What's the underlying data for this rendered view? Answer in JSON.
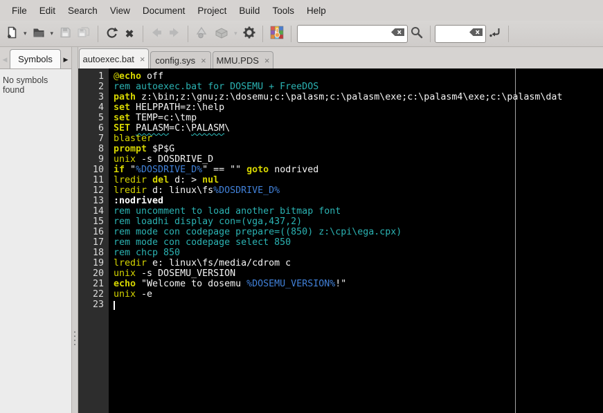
{
  "chrome_colors": {
    "window_bg": "#d6d3d1",
    "toolbar_border": "#b4b1ae",
    "active_tab_bg": "#f2f1f0",
    "inactive_tab_bg": "#d0cdcb",
    "sidebar_bg": "#ececec",
    "entry_bg": "#ffffff"
  },
  "menubar": {
    "items": [
      "File",
      "Edit",
      "Search",
      "View",
      "Document",
      "Project",
      "Build",
      "Tools",
      "Help"
    ]
  },
  "ui": {
    "close_glyph": "×",
    "close_button_glyph": "✖",
    "caret_glyph": "▾",
    "left_arrow_glyph": "◀",
    "right_arrow_glyph": "▶"
  },
  "toolbar": {
    "search_value": "",
    "goto_value": "",
    "icons": [
      "new-document",
      "open-document",
      "save",
      "save-all",
      "revert",
      "close-document",
      "navigate-back",
      "navigate-forward",
      "compile",
      "build",
      "execute-gear",
      "color-chooser",
      "search-magnifier",
      "clear-entry",
      "jump-to-line"
    ]
  },
  "sidebar": {
    "tab_label": "Symbols",
    "empty_message": "No symbols found"
  },
  "tabs": [
    {
      "label": "autoexec.bat",
      "state": "active"
    },
    {
      "label": "config.sys",
      "state": "inactive"
    },
    {
      "label": "MMU.PDS",
      "state": "inactive"
    }
  ],
  "editor": {
    "colors": {
      "editor_bg": "#000000",
      "gutter_bg": "#2d2d2d",
      "line_number": "#dcdcdc",
      "keyword": "#d6d600",
      "command": "#d6d600",
      "comment": "#2bb3b3",
      "variable": "#4181d9",
      "text": "#f5f5f5",
      "label": "#ffffff",
      "wavy_underline": "#2fc3c3",
      "marker_line": "#c2c2c2",
      "caret": "#ffffff"
    },
    "lines": [
      {
        "n": 1,
        "segs": [
          {
            "c": "cmd",
            "t": "@"
          },
          {
            "c": "kw",
            "t": "echo"
          },
          {
            "c": "txt",
            "t": " off"
          }
        ]
      },
      {
        "n": 2,
        "segs": [
          {
            "c": "com",
            "t": "rem autoexec.bat for DOSEMU + FreeDOS"
          }
        ]
      },
      {
        "n": 3,
        "segs": [
          {
            "c": "kw",
            "t": "path"
          },
          {
            "c": "txt",
            "t": " z:\\bin;z:\\gnu;z:\\dosemu;c:\\palasm;c:\\palasm\\exe;c:\\palasm4\\exe;c:\\palasm\\dat"
          }
        ]
      },
      {
        "n": 4,
        "segs": [
          {
            "c": "kw",
            "t": "set"
          },
          {
            "c": "txt",
            "t": " HELPPATH=z:\\help"
          }
        ]
      },
      {
        "n": 5,
        "segs": [
          {
            "c": "kw",
            "t": "set"
          },
          {
            "c": "txt",
            "t": " TEMP=c:\\tmp"
          }
        ]
      },
      {
        "n": 6,
        "segs": [
          {
            "c": "kw",
            "t": "SET"
          },
          {
            "c": "txt",
            "t": " "
          },
          {
            "c": "wavy",
            "t": "PALASM"
          },
          {
            "c": "txt",
            "t": "=C:\\"
          },
          {
            "c": "wavy",
            "t": "PALASM"
          },
          {
            "c": "txt",
            "t": "\\"
          }
        ]
      },
      {
        "n": 7,
        "segs": [
          {
            "c": "cmd",
            "t": "blaster"
          }
        ]
      },
      {
        "n": 8,
        "segs": [
          {
            "c": "kw",
            "t": "prompt"
          },
          {
            "c": "txt",
            "t": " $P$G"
          }
        ]
      },
      {
        "n": 9,
        "segs": [
          {
            "c": "cmd",
            "t": "unix"
          },
          {
            "c": "txt",
            "t": " -s DOSDRIVE_D"
          }
        ]
      },
      {
        "n": 10,
        "segs": [
          {
            "c": "kw",
            "t": "if"
          },
          {
            "c": "txt",
            "t": " \""
          },
          {
            "c": "var",
            "t": "%DOSDRIVE_D%"
          },
          {
            "c": "txt",
            "t": "\" == \"\" "
          },
          {
            "c": "kw",
            "t": "goto"
          },
          {
            "c": "txt",
            "t": " nodrived"
          }
        ]
      },
      {
        "n": 11,
        "segs": [
          {
            "c": "cmd",
            "t": "lredir"
          },
          {
            "c": "txt",
            "t": " "
          },
          {
            "c": "kw",
            "t": "del"
          },
          {
            "c": "txt",
            "t": " d: > "
          },
          {
            "c": "kw",
            "t": "nul"
          }
        ]
      },
      {
        "n": 12,
        "segs": [
          {
            "c": "cmd",
            "t": "lredir"
          },
          {
            "c": "txt",
            "t": " d: linux\\fs"
          },
          {
            "c": "var",
            "t": "%DOSDRIVE_D%"
          }
        ]
      },
      {
        "n": 13,
        "segs": [
          {
            "c": "lbl",
            "t": ":nodrived"
          }
        ]
      },
      {
        "n": 14,
        "segs": [
          {
            "c": "com",
            "t": "rem uncomment to load another bitmap font"
          }
        ]
      },
      {
        "n": 15,
        "segs": [
          {
            "c": "com",
            "t": "rem loadhi display con=(vga,437,2)"
          }
        ]
      },
      {
        "n": 16,
        "segs": [
          {
            "c": "com",
            "t": "rem mode con codepage prepare=((850) z:\\cpi\\ega.cpx)"
          }
        ]
      },
      {
        "n": 17,
        "segs": [
          {
            "c": "com",
            "t": "rem mode con codepage select 850"
          }
        ]
      },
      {
        "n": 18,
        "segs": [
          {
            "c": "com",
            "t": "rem chcp 850"
          }
        ]
      },
      {
        "n": 19,
        "segs": [
          {
            "c": "cmd",
            "t": "lredir"
          },
          {
            "c": "txt",
            "t": " e: linux\\fs/media/cdrom c"
          }
        ]
      },
      {
        "n": 20,
        "segs": [
          {
            "c": "cmd",
            "t": "unix"
          },
          {
            "c": "txt",
            "t": " -s DOSEMU_VERSION"
          }
        ]
      },
      {
        "n": 21,
        "segs": [
          {
            "c": "kw",
            "t": "echo"
          },
          {
            "c": "txt",
            "t": " \"Welcome to dosemu "
          },
          {
            "c": "var",
            "t": "%DOSEMU_VERSION%"
          },
          {
            "c": "txt",
            "t": "!\""
          }
        ]
      },
      {
        "n": 22,
        "segs": [
          {
            "c": "cmd",
            "t": "unix"
          },
          {
            "c": "txt",
            "t": " -e"
          }
        ]
      },
      {
        "n": 23,
        "segs": [],
        "caret": true
      }
    ]
  }
}
